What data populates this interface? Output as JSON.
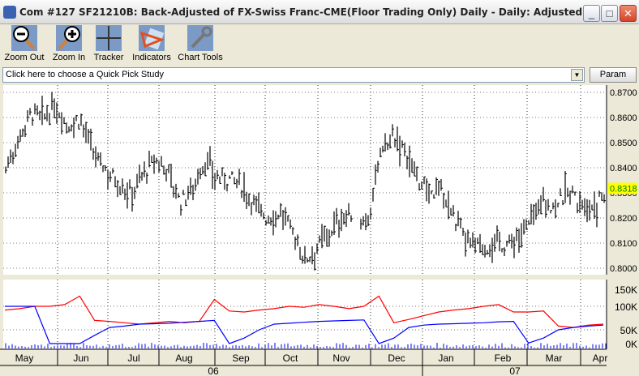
{
  "window": {
    "title": "Com #127 SF21210B: Back-Adjusted of FX-Swiss Franc-CME(Floor Trading Only) Daily - Daily: Adjusted",
    "minimize": "_",
    "maximize": "□",
    "close": "✕"
  },
  "toolbar": [
    {
      "label": "Zoom Out",
      "icon": "zoom-out-icon"
    },
    {
      "label": "Zoom In",
      "icon": "zoom-in-icon"
    },
    {
      "label": "Tracker",
      "icon": "crosshair-icon"
    },
    {
      "label": "Indicators",
      "icon": "indicators-icon"
    },
    {
      "label": "Chart Tools",
      "icon": "wrench-icon"
    }
  ],
  "quick_pick": {
    "value": "Click here to choose a Quick Pick Study",
    "param_label": "Param"
  },
  "chart_data": [
    {
      "type": "bar",
      "subtype": "ohlc",
      "title": "",
      "ylim": [
        0.8,
        0.87
      ],
      "yticks": [
        "0.8700",
        "0.8600",
        "0.8500",
        "0.8400",
        "0.8300",
        "0.8200",
        "0.8100",
        "0.8000"
      ],
      "last_price": "0.8318",
      "last_price_color": "#ffff00",
      "grid": true,
      "weekly_close": [
        0.84,
        0.852,
        0.862,
        0.86,
        0.865,
        0.857,
        0.86,
        0.846,
        0.84,
        0.835,
        0.83,
        0.838,
        0.843,
        0.84,
        0.826,
        0.833,
        0.843,
        0.836,
        0.836,
        0.833,
        0.826,
        0.82,
        0.823,
        0.815,
        0.804,
        0.809,
        0.815,
        0.821,
        0.822,
        0.82,
        0.843,
        0.853,
        0.847,
        0.836,
        0.83,
        0.831,
        0.819,
        0.81,
        0.808,
        0.81,
        0.81,
        0.812,
        0.818,
        0.828,
        0.825,
        0.83,
        0.828,
        0.825,
        0.829
      ]
    },
    {
      "type": "line",
      "ylim": [
        0,
        150000
      ],
      "yticks": [
        "150K",
        "100K",
        "50K",
        "0K"
      ],
      "grid": true,
      "series": [
        {
          "color": "#ff0000",
          "values": [
            92,
            95,
            100,
            100,
            105,
            130,
            70,
            68,
            65,
            62,
            65,
            68,
            65,
            68,
            120,
            90,
            88,
            92,
            95,
            100,
            98,
            105,
            100,
            95,
            100,
            130,
            65,
            72,
            80,
            88,
            92,
            95,
            100,
            105,
            88,
            88,
            90,
            58,
            55,
            60,
            62
          ]
        },
        {
          "color": "#0000ff",
          "values": [
            100,
            100,
            100,
            0,
            0,
            0,
            30,
            55,
            58,
            62,
            63,
            64,
            66,
            68,
            70,
            0,
            20,
            50,
            62,
            64,
            66,
            68,
            69,
            70,
            71,
            0,
            20,
            55,
            60,
            62,
            63,
            64,
            65,
            67,
            68,
            2,
            20,
            50,
            55,
            58,
            60
          ]
        }
      ]
    }
  ],
  "x_axis": {
    "months": [
      "May",
      "Jun",
      "Jul",
      "Aug",
      "Sep",
      "Oct",
      "Nov",
      "Dec",
      "Jan",
      "Feb",
      "Mar",
      "Apr"
    ],
    "years": [
      "06",
      "07"
    ]
  }
}
